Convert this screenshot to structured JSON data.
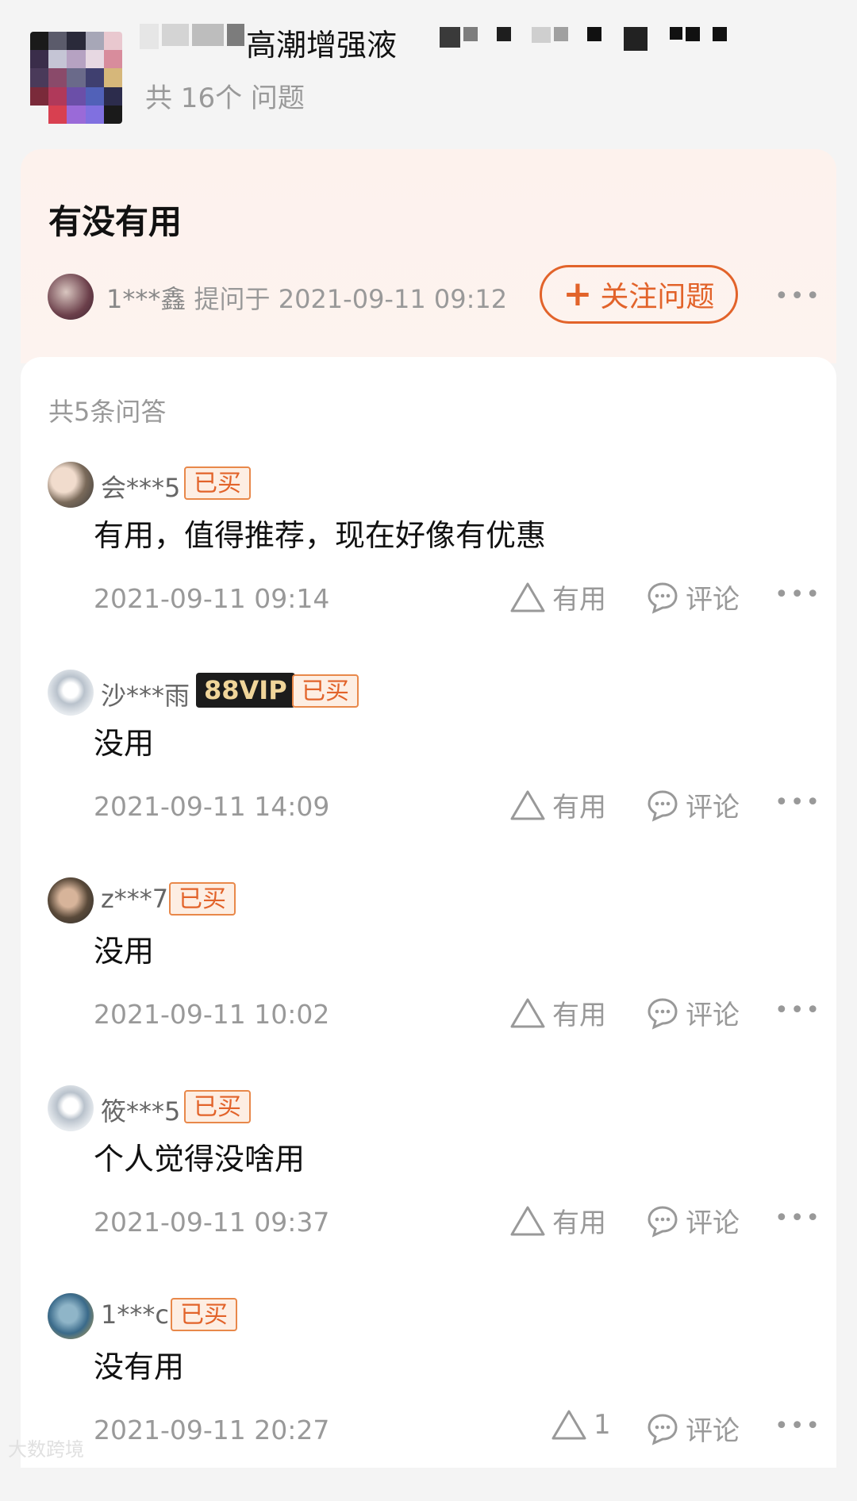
{
  "header": {
    "product_title": "高潮增强液",
    "question_count": "共 16个 问题"
  },
  "question": {
    "title": "有没有用",
    "asker": "1***鑫",
    "asked_at": "提问于 2021-09-11 09:12",
    "follow_label": "关注问题",
    "follow_icon": "plus-icon",
    "more": "•••"
  },
  "answers_header": {
    "count": "共5条问答"
  },
  "answers": [
    {
      "user": "会***5",
      "vip": "",
      "bought": "已买",
      "text": "有用，值得推荐，现在好像有优惠",
      "date": "2021-09-11 09:14",
      "useful": "有用",
      "comment": "评论",
      "more": "•••"
    },
    {
      "user": "沙***雨",
      "vip": "88VIP",
      "bought": "已买",
      "text": "没用",
      "date": "2021-09-11 14:09",
      "useful": "有用",
      "comment": "评论",
      "more": "•••"
    },
    {
      "user": "z***7",
      "vip": "",
      "bought": "已买",
      "text": "没用",
      "date": "2021-09-11 10:02",
      "useful": "有用",
      "comment": "评论",
      "more": "•••"
    },
    {
      "user": "筱***5",
      "vip": "",
      "bought": "已买",
      "text": "个人觉得没啥用",
      "date": "2021-09-11 09:37",
      "useful": "有用",
      "comment": "评论",
      "more": "•••"
    },
    {
      "user": "1***c",
      "vip": "",
      "bought": "已买",
      "text": "没有用",
      "date": "2021-09-11 20:27",
      "useful": "1",
      "comment": "评论",
      "more": "•••"
    }
  ],
  "watermark": "大数跨境",
  "colors": {
    "accent": "#e2632a",
    "muted": "#999999",
    "question_bg": "#fdf2ed",
    "vip_bg": "#1c1c1c",
    "vip_text": "#f0d59a"
  }
}
